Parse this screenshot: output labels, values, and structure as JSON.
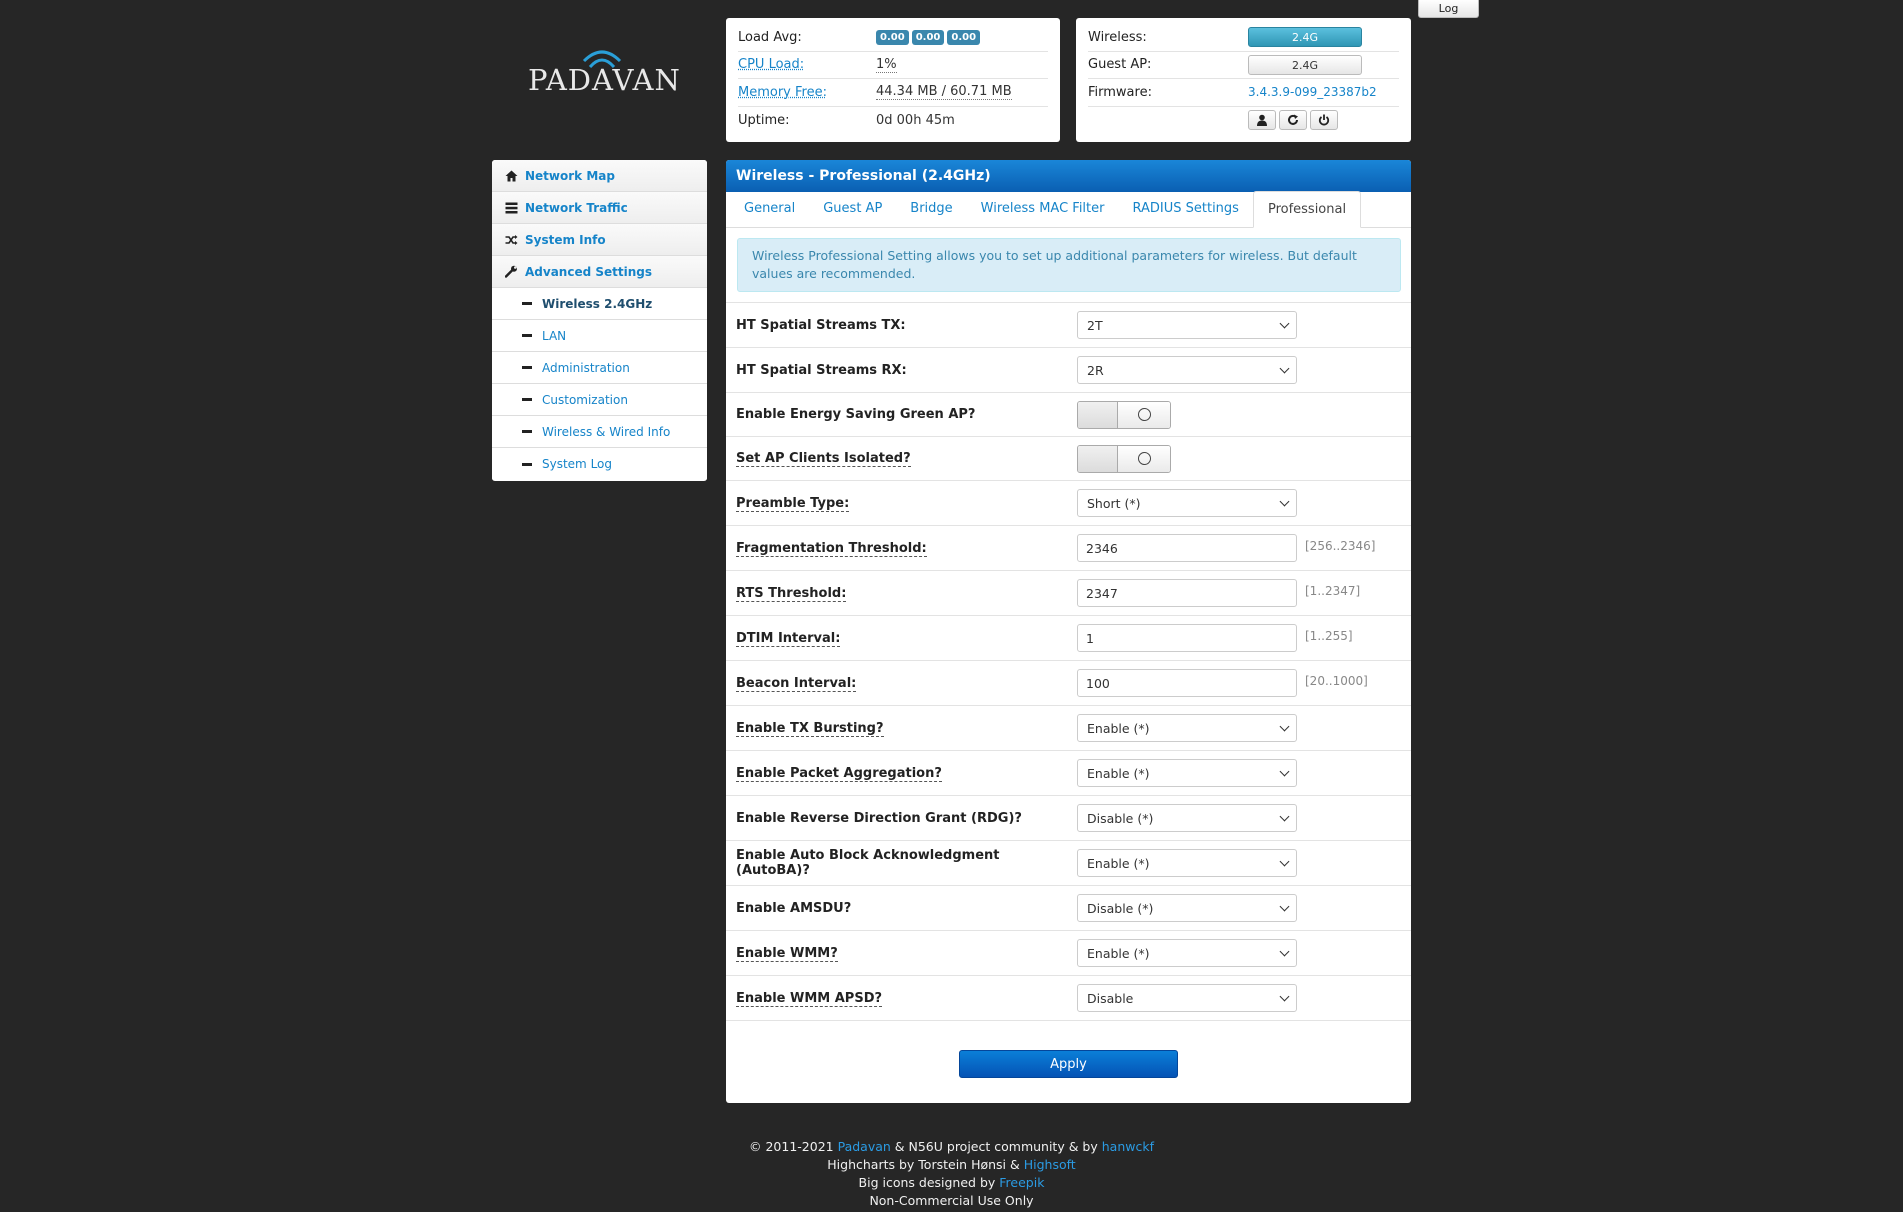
{
  "header": {
    "log_button": "Log",
    "logo_text": "PADAVAN"
  },
  "status": {
    "load_avg_label": "Load Avg:",
    "load_avg_values": [
      "0.00",
      "0.00",
      "0.00"
    ],
    "cpu_label": "CPU Load:",
    "cpu_value": "1%",
    "memory_label": "Memory Free:",
    "memory_value": "44.34 MB / 60.71 MB",
    "uptime_label": "Uptime:",
    "uptime_value": "0d 00h 45m"
  },
  "device": {
    "wireless_label": "Wireless:",
    "wireless_value": "2.4G",
    "guest_label": "Guest AP:",
    "guest_value": "2.4G",
    "firmware_label": "Firmware:",
    "firmware_value": "3.4.3.9-099_23387b2",
    "icons": [
      "user-icon",
      "refresh-icon",
      "power-icon"
    ]
  },
  "sidebar": {
    "items": [
      {
        "label": "Network Map",
        "icon": "home-icon"
      },
      {
        "label": "Network Traffic",
        "icon": "list-icon"
      },
      {
        "label": "System Info",
        "icon": "shuffle-icon"
      },
      {
        "label": "Advanced Settings",
        "icon": "wrench-icon"
      }
    ],
    "subitems": [
      {
        "label": "Wireless 2.4GHz",
        "active": true
      },
      {
        "label": "LAN"
      },
      {
        "label": "Administration"
      },
      {
        "label": "Customization"
      },
      {
        "label": "Wireless & Wired Info"
      },
      {
        "label": "System Log"
      }
    ]
  },
  "panel": {
    "title": "Wireless - Professional (2.4GHz)",
    "tabs": [
      "General",
      "Guest AP",
      "Bridge",
      "Wireless MAC Filter",
      "RADIUS Settings",
      "Professional"
    ],
    "active_tab": "Professional",
    "alert": "Wireless Professional Setting allows you to set up additional parameters for wireless. But default values are recommended."
  },
  "form": {
    "ht_tx_label": "HT Spatial Streams TX:",
    "ht_tx_value": "2T",
    "ht_rx_label": "HT Spatial Streams RX:",
    "ht_rx_value": "2R",
    "green_ap_label": "Enable Energy Saving Green AP?",
    "isolated_label": "Set AP Clients Isolated?",
    "preamble_label": "Preamble Type:",
    "preamble_value": "Short (*)",
    "frag_label": "Fragmentation Threshold:",
    "frag_value": "2346",
    "frag_hint": "[256..2346]",
    "rts_label": "RTS Threshold:",
    "rts_value": "2347",
    "rts_hint": "[1..2347]",
    "dtim_label": "DTIM Interval:",
    "dtim_value": "1",
    "dtim_hint": "[1..255]",
    "beacon_label": "Beacon Interval:",
    "beacon_value": "100",
    "beacon_hint": "[20..1000]",
    "txburst_label": "Enable TX Bursting?",
    "txburst_value": "Enable (*)",
    "pktagg_label": "Enable Packet Aggregation?",
    "pktagg_value": "Enable (*)",
    "rdg_label": "Enable Reverse Direction Grant (RDG)?",
    "rdg_value": "Disable (*)",
    "autoba_label": "Enable Auto Block Acknowledgment (AutoBA)?",
    "autoba_value": "Enable (*)",
    "amsdu_label": "Enable AMSDU?",
    "amsdu_value": "Disable (*)",
    "wmm_label": "Enable WMM?",
    "wmm_value": "Enable (*)",
    "apsd_label": "Enable WMM APSD?",
    "apsd_value": "Disable",
    "apply_label": "Apply"
  },
  "footer": {
    "line1_prefix": "© 2011-2021 ",
    "line1_link1": "Padavan",
    "line1_mid": " & N56U project community & by ",
    "line1_link2": "hanwckf",
    "line2_prefix": "Highcharts by Torstein Hønsi & ",
    "line2_link": "Highsoft",
    "line3_prefix": "Big icons designed by ",
    "line3_link": "Freepik",
    "line4": "Non-Commercial Use Only"
  }
}
